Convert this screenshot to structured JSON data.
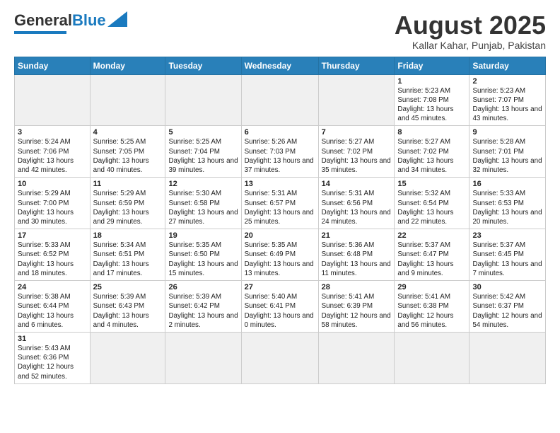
{
  "header": {
    "logo_general": "General",
    "logo_blue": "Blue",
    "month_year": "August 2025",
    "location": "Kallar Kahar, Punjab, Pakistan"
  },
  "days_of_week": [
    "Sunday",
    "Monday",
    "Tuesday",
    "Wednesday",
    "Thursday",
    "Friday",
    "Saturday"
  ],
  "weeks": [
    [
      {
        "day": "",
        "info": ""
      },
      {
        "day": "",
        "info": ""
      },
      {
        "day": "",
        "info": ""
      },
      {
        "day": "",
        "info": ""
      },
      {
        "day": "",
        "info": ""
      },
      {
        "day": "1",
        "info": "Sunrise: 5:23 AM\nSunset: 7:08 PM\nDaylight: 13 hours and 45 minutes."
      },
      {
        "day": "2",
        "info": "Sunrise: 5:23 AM\nSunset: 7:07 PM\nDaylight: 13 hours and 43 minutes."
      }
    ],
    [
      {
        "day": "3",
        "info": "Sunrise: 5:24 AM\nSunset: 7:06 PM\nDaylight: 13 hours and 42 minutes."
      },
      {
        "day": "4",
        "info": "Sunrise: 5:25 AM\nSunset: 7:05 PM\nDaylight: 13 hours and 40 minutes."
      },
      {
        "day": "5",
        "info": "Sunrise: 5:25 AM\nSunset: 7:04 PM\nDaylight: 13 hours and 39 minutes."
      },
      {
        "day": "6",
        "info": "Sunrise: 5:26 AM\nSunset: 7:03 PM\nDaylight: 13 hours and 37 minutes."
      },
      {
        "day": "7",
        "info": "Sunrise: 5:27 AM\nSunset: 7:02 PM\nDaylight: 13 hours and 35 minutes."
      },
      {
        "day": "8",
        "info": "Sunrise: 5:27 AM\nSunset: 7:02 PM\nDaylight: 13 hours and 34 minutes."
      },
      {
        "day": "9",
        "info": "Sunrise: 5:28 AM\nSunset: 7:01 PM\nDaylight: 13 hours and 32 minutes."
      }
    ],
    [
      {
        "day": "10",
        "info": "Sunrise: 5:29 AM\nSunset: 7:00 PM\nDaylight: 13 hours and 30 minutes."
      },
      {
        "day": "11",
        "info": "Sunrise: 5:29 AM\nSunset: 6:59 PM\nDaylight: 13 hours and 29 minutes."
      },
      {
        "day": "12",
        "info": "Sunrise: 5:30 AM\nSunset: 6:58 PM\nDaylight: 13 hours and 27 minutes."
      },
      {
        "day": "13",
        "info": "Sunrise: 5:31 AM\nSunset: 6:57 PM\nDaylight: 13 hours and 25 minutes."
      },
      {
        "day": "14",
        "info": "Sunrise: 5:31 AM\nSunset: 6:56 PM\nDaylight: 13 hours and 24 minutes."
      },
      {
        "day": "15",
        "info": "Sunrise: 5:32 AM\nSunset: 6:54 PM\nDaylight: 13 hours and 22 minutes."
      },
      {
        "day": "16",
        "info": "Sunrise: 5:33 AM\nSunset: 6:53 PM\nDaylight: 13 hours and 20 minutes."
      }
    ],
    [
      {
        "day": "17",
        "info": "Sunrise: 5:33 AM\nSunset: 6:52 PM\nDaylight: 13 hours and 18 minutes."
      },
      {
        "day": "18",
        "info": "Sunrise: 5:34 AM\nSunset: 6:51 PM\nDaylight: 13 hours and 17 minutes."
      },
      {
        "day": "19",
        "info": "Sunrise: 5:35 AM\nSunset: 6:50 PM\nDaylight: 13 hours and 15 minutes."
      },
      {
        "day": "20",
        "info": "Sunrise: 5:35 AM\nSunset: 6:49 PM\nDaylight: 13 hours and 13 minutes."
      },
      {
        "day": "21",
        "info": "Sunrise: 5:36 AM\nSunset: 6:48 PM\nDaylight: 13 hours and 11 minutes."
      },
      {
        "day": "22",
        "info": "Sunrise: 5:37 AM\nSunset: 6:47 PM\nDaylight: 13 hours and 9 minutes."
      },
      {
        "day": "23",
        "info": "Sunrise: 5:37 AM\nSunset: 6:45 PM\nDaylight: 13 hours and 7 minutes."
      }
    ],
    [
      {
        "day": "24",
        "info": "Sunrise: 5:38 AM\nSunset: 6:44 PM\nDaylight: 13 hours and 6 minutes."
      },
      {
        "day": "25",
        "info": "Sunrise: 5:39 AM\nSunset: 6:43 PM\nDaylight: 13 hours and 4 minutes."
      },
      {
        "day": "26",
        "info": "Sunrise: 5:39 AM\nSunset: 6:42 PM\nDaylight: 13 hours and 2 minutes."
      },
      {
        "day": "27",
        "info": "Sunrise: 5:40 AM\nSunset: 6:41 PM\nDaylight: 13 hours and 0 minutes."
      },
      {
        "day": "28",
        "info": "Sunrise: 5:41 AM\nSunset: 6:39 PM\nDaylight: 12 hours and 58 minutes."
      },
      {
        "day": "29",
        "info": "Sunrise: 5:41 AM\nSunset: 6:38 PM\nDaylight: 12 hours and 56 minutes."
      },
      {
        "day": "30",
        "info": "Sunrise: 5:42 AM\nSunset: 6:37 PM\nDaylight: 12 hours and 54 minutes."
      }
    ],
    [
      {
        "day": "31",
        "info": "Sunrise: 5:43 AM\nSunset: 6:36 PM\nDaylight: 12 hours and 52 minutes."
      },
      {
        "day": "",
        "info": ""
      },
      {
        "day": "",
        "info": ""
      },
      {
        "day": "",
        "info": ""
      },
      {
        "day": "",
        "info": ""
      },
      {
        "day": "",
        "info": ""
      },
      {
        "day": "",
        "info": ""
      }
    ]
  ]
}
